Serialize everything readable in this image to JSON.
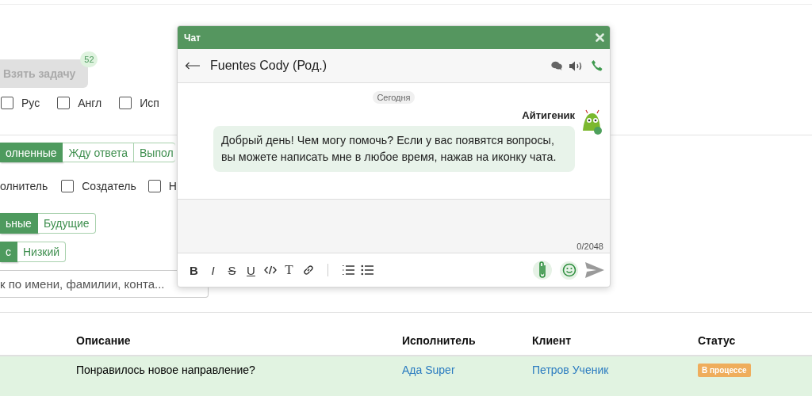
{
  "task_button": {
    "label": "Взять задачу",
    "badge": "52",
    "disabled": true
  },
  "languages": [
    {
      "label": "Рус",
      "checked": false
    },
    {
      "label": "Англ",
      "checked": false
    },
    {
      "label": "Исп",
      "checked": false
    }
  ],
  "status_tabs": [
    {
      "label": "олненные",
      "selected": true
    },
    {
      "label": "Жду ответа",
      "selected": false
    },
    {
      "label": "Выпол",
      "selected": false
    }
  ],
  "role_filters": [
    {
      "label": "олнитель"
    },
    {
      "label": "Создатель",
      "checked": false
    },
    {
      "label": "Н",
      "checked": false
    }
  ],
  "period_tabs": [
    {
      "label": "ьные",
      "selected": true
    },
    {
      "label": "Будущие",
      "selected": false
    }
  ],
  "priority_tabs": [
    {
      "label": "с",
      "selected": true
    },
    {
      "label": "Низкий",
      "selected": false
    }
  ],
  "search": {
    "placeholder": "к по имени, фамилии, конта..."
  },
  "table": {
    "columns": [
      "Описание",
      "Исполнитель",
      "Клиент",
      "Статус"
    ],
    "rows": [
      {
        "description": "Понравилось новое направление?",
        "assignee": "Ада Super",
        "client": "Петров Ученик",
        "status": "В процессе"
      }
    ]
  },
  "chat": {
    "title": "Чат",
    "contact": "Fuentes Cody (Род.)",
    "date_label": "Сегодня",
    "messages": [
      {
        "author": "Айтигеник",
        "text": "Добрый день! Чем могу помочь? Если у вас появятся вопросы, вы можете написать мне в любое время, нажав на иконку чата."
      }
    ],
    "counter": "0/2048",
    "format_buttons": [
      {
        "kind": "glyph",
        "label": "B"
      },
      {
        "kind": "glyph",
        "label": "I"
      },
      {
        "kind": "glyph",
        "label": "S"
      },
      {
        "kind": "glyph",
        "label": "U"
      },
      {
        "kind": "code"
      },
      {
        "kind": "glyph",
        "label": "T"
      },
      {
        "kind": "link"
      }
    ]
  }
}
